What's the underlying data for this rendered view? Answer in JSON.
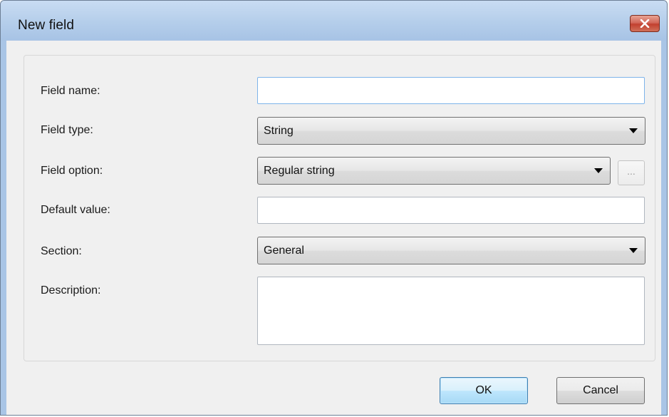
{
  "dialog": {
    "title": "New field",
    "close_icon": "close-icon"
  },
  "form": {
    "field_name": {
      "label": "Field name:",
      "value": ""
    },
    "field_type": {
      "label": "Field type:",
      "value": "String"
    },
    "field_option": {
      "label": "Field option:",
      "value": "Regular string",
      "browse_label": "..."
    },
    "default_value": {
      "label": "Default value:",
      "value": ""
    },
    "section": {
      "label": "Section:",
      "value": "General"
    },
    "description": {
      "label": "Description:",
      "value": ""
    }
  },
  "buttons": {
    "ok_label": "OK",
    "cancel_label": "Cancel"
  },
  "colors": {
    "titlebar": "#b6cfeb",
    "client_bg": "#f0f0f0",
    "close_button": "#c2402f",
    "default_button_border": "#3c7fb1"
  }
}
